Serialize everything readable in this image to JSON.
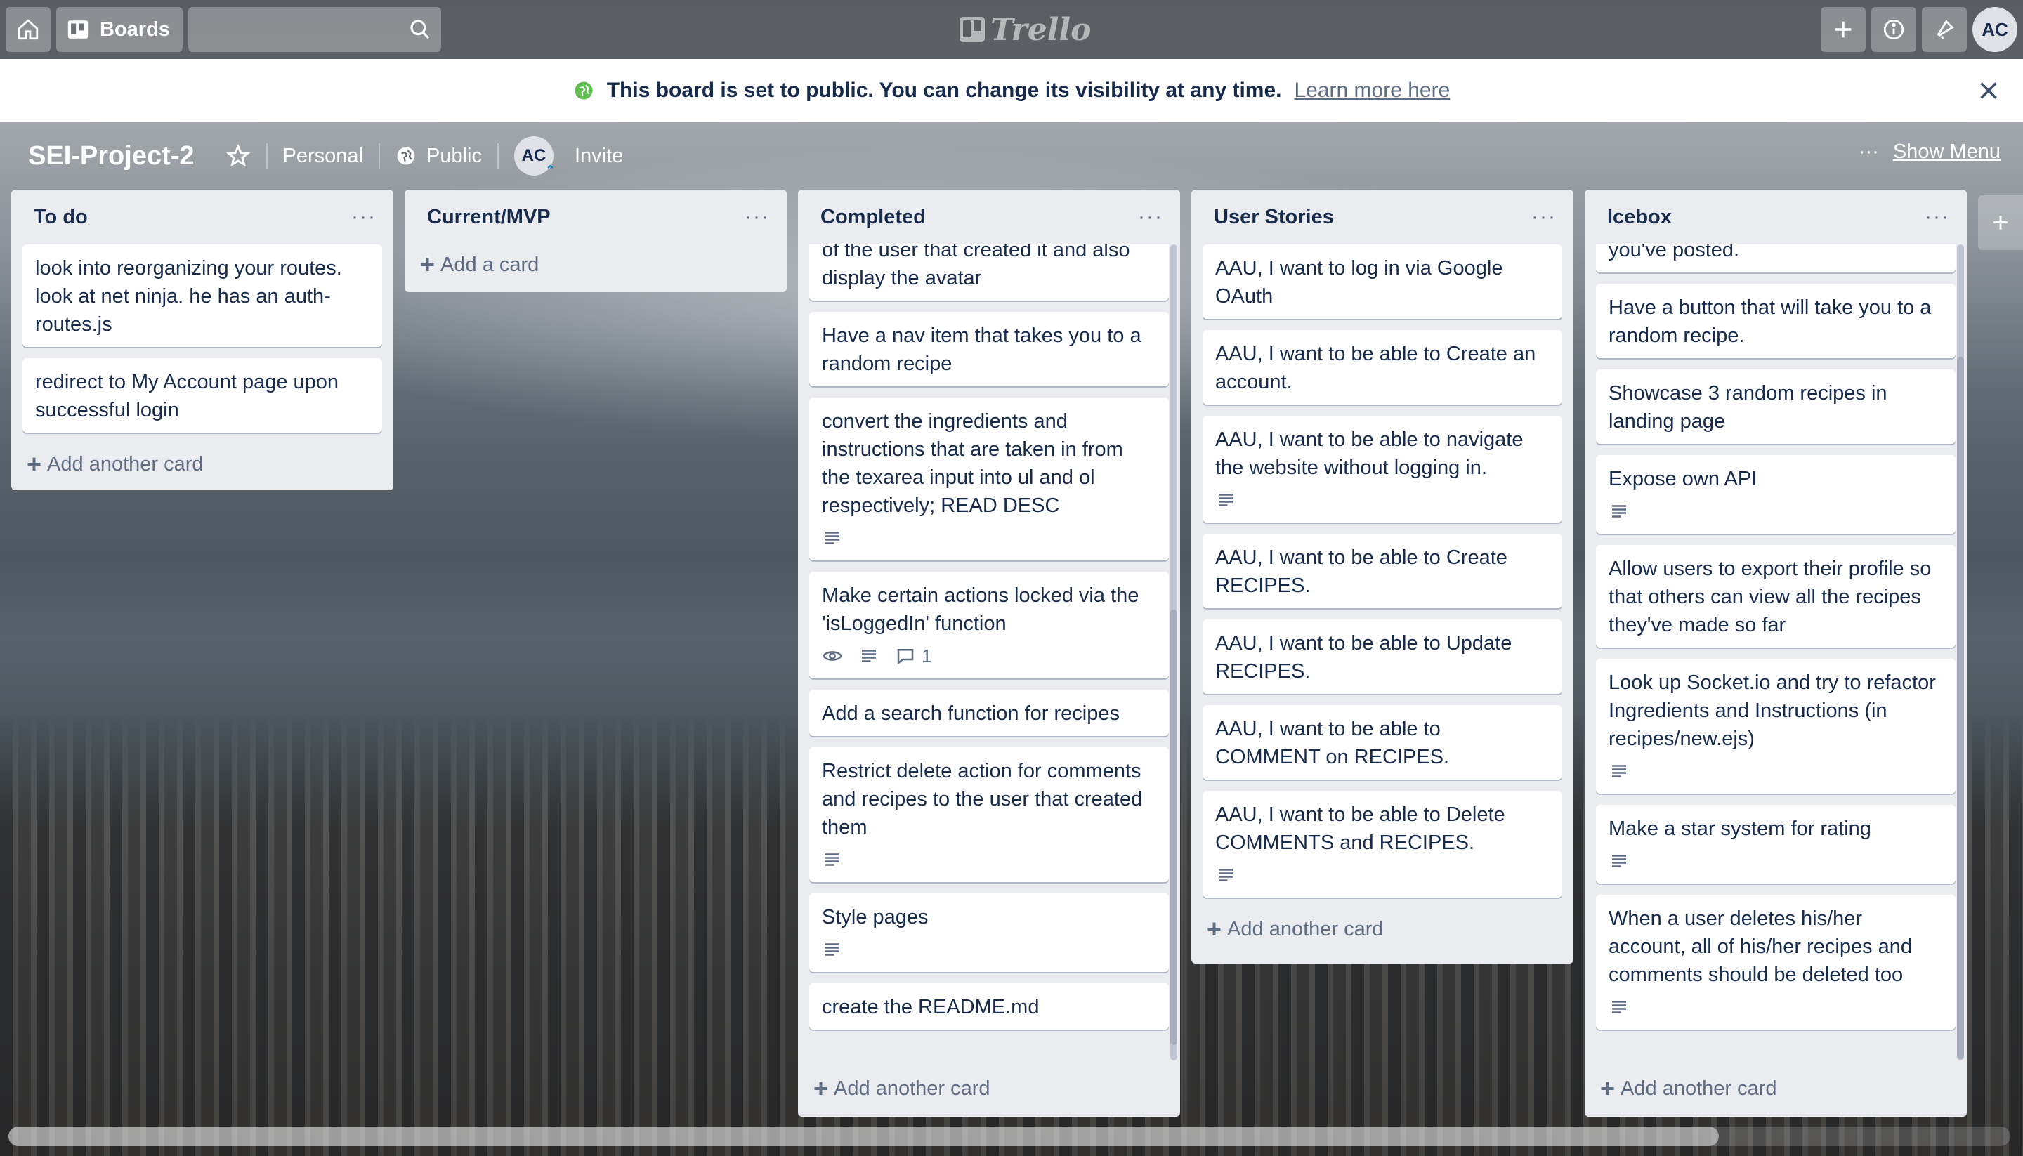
{
  "header": {
    "boards_label": "Boards",
    "search_placeholder": "",
    "logo_text": "Trello",
    "avatar_initials": "AC",
    "icons": [
      "home-icon",
      "boards-icon",
      "search-icon",
      "plus-icon",
      "info-icon",
      "bell-icon"
    ]
  },
  "banner": {
    "message": "This board is set to public. You can change its visibility at any time.",
    "link": "Learn more here"
  },
  "board": {
    "title": "SEI-Project-2",
    "team": "Personal",
    "visibility": "Public",
    "member_initials": "AC",
    "invite": "Invite",
    "show_menu": "Show Menu"
  },
  "lists": [
    {
      "title": "To do",
      "cards": [
        {
          "text": "look into reorganizing your routes. look at net ninja. he has an auth-routes.js",
          "desc": false
        },
        {
          "text": "redirect to My Account page upon successful login",
          "desc": false
        }
      ],
      "add_label": "Add another card"
    },
    {
      "title": "Current/MVP",
      "cards": [],
      "add_label": "Add a card"
    },
    {
      "title": "Completed",
      "cards": [
        {
          "text": "of the user that created it and also display the avatar",
          "desc": false
        },
        {
          "text": "Have a nav item that takes you to a random recipe",
          "desc": false
        },
        {
          "text": "convert the ingredients and instructions that are taken in from the texarea input into ul and ol respectively; READ DESC",
          "desc": true
        },
        {
          "text": "Make certain actions locked via the 'isLoggedIn' function",
          "desc": true,
          "watch": true,
          "comments": "1"
        },
        {
          "text": "Add a search function for recipes",
          "desc": false
        },
        {
          "text": "Restrict delete action for comments and recipes to the user that created them",
          "desc": true
        },
        {
          "text": "Style pages",
          "desc": true
        },
        {
          "text": "create the README.md",
          "desc": false
        }
      ],
      "add_label": "Add another card"
    },
    {
      "title": "User Stories",
      "cards": [
        {
          "text": "AAU, I want to log in via Google OAuth",
          "desc": false
        },
        {
          "text": "AAU, I want to be able to Create an account.",
          "desc": false
        },
        {
          "text": "AAU, I want to be able to navigate the website without logging in.",
          "desc": true
        },
        {
          "text": "AAU, I want to be able to Create RECIPES.",
          "desc": false
        },
        {
          "text": "AAU, I want to be able to Update RECIPES.",
          "desc": false
        },
        {
          "text": "AAU, I want to be able to COMMENT on RECIPES.",
          "desc": false
        },
        {
          "text": "AAU, I want to be able to Delete COMMENTS and RECIPES.",
          "desc": true
        }
      ],
      "add_label": "Add another card"
    },
    {
      "title": "Icebox",
      "cards": [
        {
          "text": "you've posted.",
          "desc": false
        },
        {
          "text": "Have a button that will take you to a random recipe.",
          "desc": false
        },
        {
          "text": "Showcase 3 random recipes in landing page",
          "desc": false
        },
        {
          "text": "Expose own API",
          "desc": true
        },
        {
          "text": "Allow users to export their profile so that others can view all the recipes they've made so far",
          "desc": false
        },
        {
          "text": "Look up Socket.io and try to refactor Ingredients and Instructions (in recipes/new.ejs)",
          "desc": true
        },
        {
          "text": "Make a star system for rating",
          "desc": true
        },
        {
          "text": "When a user deletes his/her account, all of his/her recipes and comments should be deleted too",
          "desc": true
        }
      ],
      "add_label": "Add another card"
    }
  ],
  "add_list_label": "+"
}
